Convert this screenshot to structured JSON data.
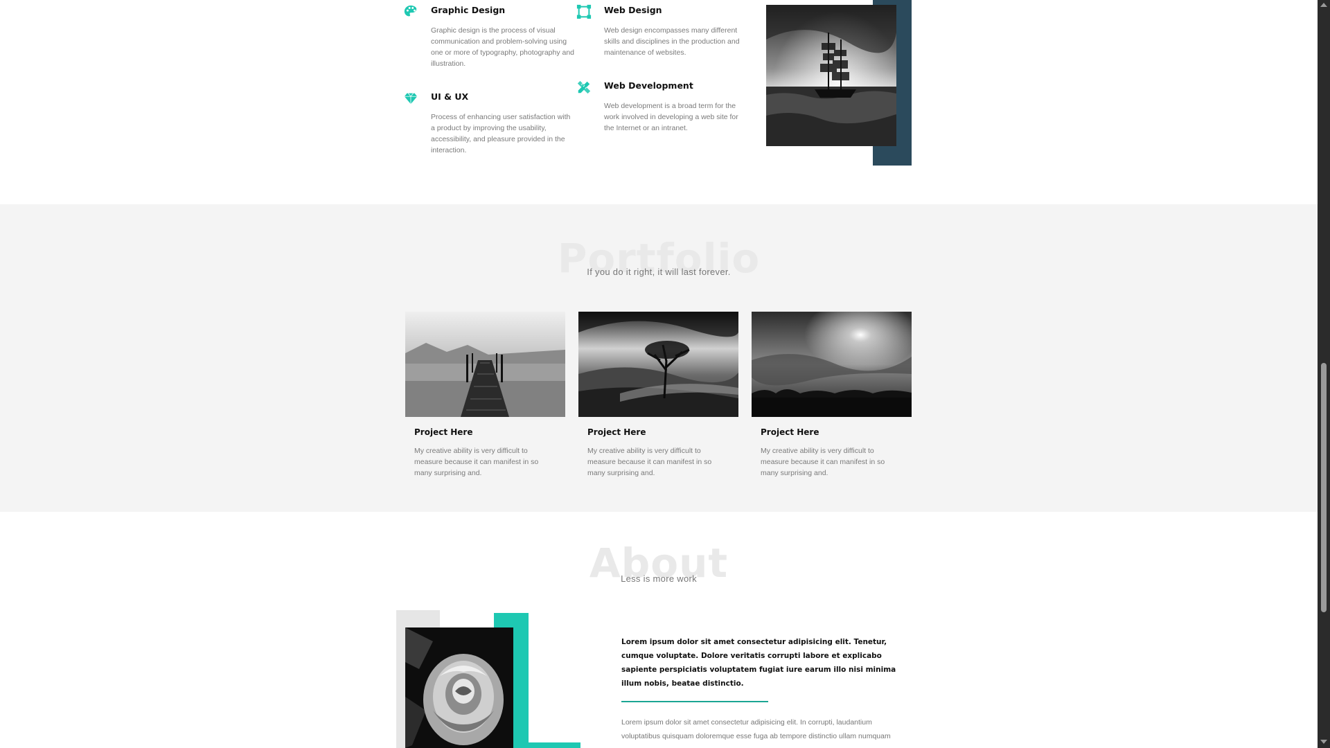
{
  "accent_color": "#1ec8b2",
  "dark_accent_color": "#2b4a5c",
  "services": {
    "items": [
      {
        "title": "Graphic Design",
        "icon": "palette-icon",
        "text": "Graphic design is the process of visual communication and problem-solving using one or more of typography, photography and illustration."
      },
      {
        "title": "Web Design",
        "icon": "bezier-frame-icon",
        "text": "Web design encompasses many different skills and disciplines in the production and maintenance of websites."
      },
      {
        "title": "UI & UX",
        "icon": "gem-icon",
        "text": "Process of enhancing user satisfaction with a product by improving the usability, accessibility, and pleasure provided in the interaction."
      },
      {
        "title": "Web Development",
        "icon": "pencil-ruler-icon",
        "text": "Web development is a broad term for the work involved in developing a web site for the Internet or an intranet."
      }
    ]
  },
  "portfolio": {
    "title": "Portfolio",
    "subtitle": "If you do it right, it will last forever.",
    "cards": [
      {
        "title": "Project Here",
        "text": "My creative ability is very difficult to measure because it can manifest in so many surprising and."
      },
      {
        "title": "Project Here",
        "text": "My creative ability is very difficult to measure because it can manifest in so many surprising and."
      },
      {
        "title": "Project Here",
        "text": "My creative ability is very difficult to measure because it can manifest in so many surprising and."
      }
    ]
  },
  "about": {
    "title": "About",
    "subtitle": "Less is more work",
    "lead": "Lorem ipsum dolor sit amet consectetur adipisicing elit. Tenetur, cumque voluptate. Dolore veritatis corrupti labore et explicabo sapiente perspiciatis voluptatem fugiat iure earum illo nisi minima illum nobis, beatae distinctio.",
    "body": "Lorem ipsum dolor sit amet consectetur adipisicing elit. In corrupti, laudantium voluptatibus quisquam doloremque esse fuga ab tempore distinctio ullam numquam"
  }
}
